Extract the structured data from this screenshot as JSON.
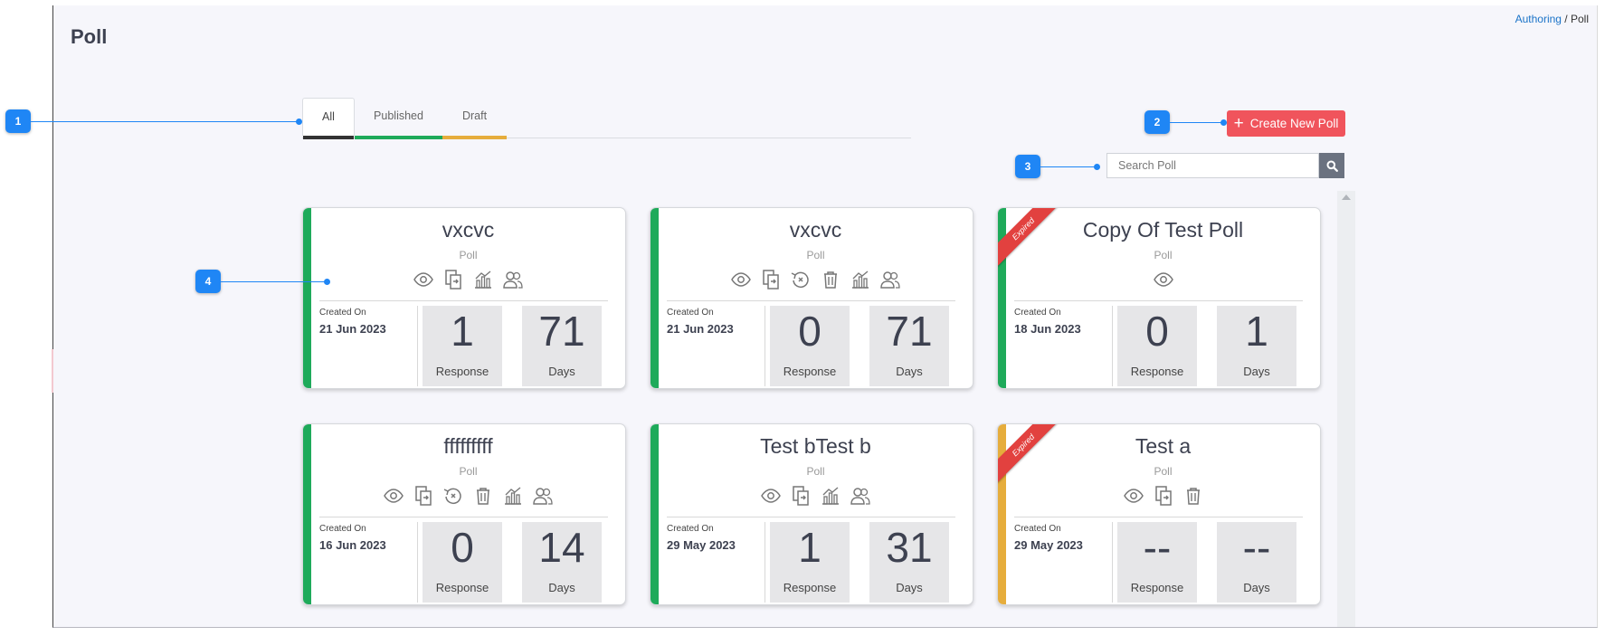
{
  "page": {
    "title": "Poll"
  },
  "breadcrumb": {
    "parent": "Authoring",
    "separator": " / ",
    "current": "Poll"
  },
  "tabs": [
    {
      "label": "All",
      "color": "#333333",
      "active": true
    },
    {
      "label": "Published",
      "color": "#1eaa5a",
      "active": false
    },
    {
      "label": "Draft",
      "color": "#e6ad3c",
      "active": false
    }
  ],
  "toolbar": {
    "create_label": "Create New Poll",
    "search_placeholder": "Search Poll"
  },
  "cards": [
    {
      "title": "vxcvc",
      "type": "Poll",
      "status_color": "#1eaa5a",
      "ribbon": "",
      "icons": [
        "eye-icon",
        "copy-icon",
        "analytics-icon",
        "users-icon"
      ],
      "created_label": "Created On",
      "created_date": "21 Jun 2023",
      "responses": "1",
      "responses_label": "Response",
      "days": "71",
      "days_label": "Days"
    },
    {
      "title": "vxcvc",
      "type": "Poll",
      "status_color": "#1eaa5a",
      "ribbon": "",
      "icons": [
        "eye-icon",
        "copy-icon",
        "revert-icon",
        "trash-icon",
        "analytics-icon",
        "users-icon"
      ],
      "created_label": "Created On",
      "created_date": "21 Jun 2023",
      "responses": "0",
      "responses_label": "Response",
      "days": "71",
      "days_label": "Days"
    },
    {
      "title": "Copy Of Test Poll",
      "type": "Poll",
      "status_color": "#1eaa5a",
      "ribbon": "Expired",
      "icons": [
        "eye-icon"
      ],
      "created_label": "Created On",
      "created_date": "18 Jun 2023",
      "responses": "0",
      "responses_label": "Response",
      "days": "1",
      "days_label": "Days"
    },
    {
      "title": "fffffffff",
      "type": "Poll",
      "status_color": "#1eaa5a",
      "ribbon": "",
      "icons": [
        "eye-icon",
        "copy-icon",
        "revert-icon",
        "trash-icon",
        "analytics-icon",
        "users-icon"
      ],
      "created_label": "Created On",
      "created_date": "16 Jun 2023",
      "responses": "0",
      "responses_label": "Response",
      "days": "14",
      "days_label": "Days"
    },
    {
      "title": "Test bTest b",
      "type": "Poll",
      "status_color": "#1eaa5a",
      "ribbon": "",
      "icons": [
        "eye-icon",
        "copy-icon",
        "analytics-icon",
        "users-icon"
      ],
      "created_label": "Created On",
      "created_date": "29 May 2023",
      "responses": "1",
      "responses_label": "Response",
      "days": "31",
      "days_label": "Days"
    },
    {
      "title": "Test a",
      "type": "Poll",
      "status_color": "#e6ad3c",
      "ribbon": "Expired",
      "icons": [
        "eye-icon",
        "copy-icon",
        "trash-icon"
      ],
      "created_label": "Created On",
      "created_date": "29 May 2023",
      "responses": "--",
      "responses_label": "Response",
      "days": "--",
      "days_label": "Days"
    }
  ],
  "callouts": [
    "1",
    "2",
    "3",
    "4"
  ],
  "colors": {
    "accent_blue": "#1f86f5",
    "create_red": "#f0545c",
    "ribbon_red": "#e2413f"
  }
}
